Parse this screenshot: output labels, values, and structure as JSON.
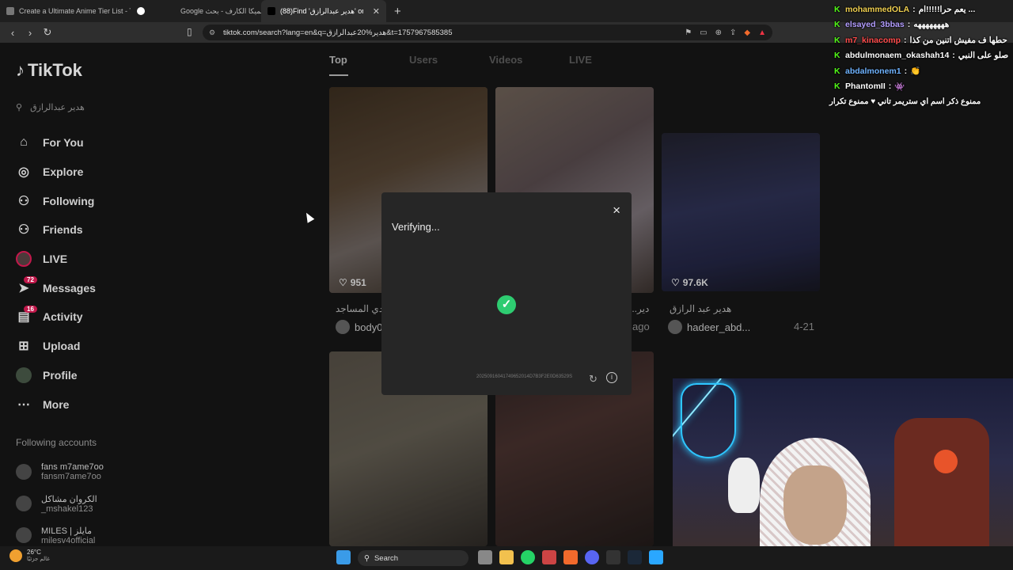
{
  "browser": {
    "tabs": [
      {
        "label": "Create a Ultimate Anime Tier List - Ti",
        "active": false
      },
      {
        "label": "",
        "active": false
      },
      {
        "label": "Google هميكا الكارف - بحث",
        "active": false
      },
      {
        "label": "(88)Find 'هدير عبدالرازق' on TikTo",
        "active": true
      }
    ],
    "url": "tiktok.com/search?lang=en&q=هدير%20عبدالرازق&t=1757967585385"
  },
  "sidebar": {
    "logo": "TikTok",
    "search_placeholder": "هدير عبدالرازق",
    "nav": [
      {
        "label": "For You",
        "icon": "home-icon"
      },
      {
        "label": "Explore",
        "icon": "compass-icon"
      },
      {
        "label": "Following",
        "icon": "following-icon"
      },
      {
        "label": "Friends",
        "icon": "friends-icon"
      },
      {
        "label": "LIVE",
        "icon": "live-icon"
      },
      {
        "label": "Messages",
        "icon": "messages-icon",
        "badge": "72"
      },
      {
        "label": "Activity",
        "icon": "activity-icon",
        "badge": "16"
      },
      {
        "label": "Upload",
        "icon": "upload-icon"
      },
      {
        "label": "Profile",
        "icon": "profile-icon"
      },
      {
        "label": "More",
        "icon": "more-icon"
      }
    ],
    "following_title": "Following accounts",
    "following": [
      {
        "name": "fans m7ame7oo",
        "handle": "fansm7ame7oo"
      },
      {
        "name": "الكروان مشاكل",
        "handle": "_mshakel123"
      },
      {
        "name": "MILES | مايلز",
        "handle": "milesv4official"
      }
    ]
  },
  "main": {
    "tabs": [
      "Top",
      "Users",
      "Videos",
      "LIVE"
    ],
    "cards": [
      {
        "likes": "951",
        "desc": "تحدي المساجد",
        "author": "body0",
        "date": ""
      },
      {
        "likes": "",
        "desc": "...دير",
        "author": "",
        "date": "ago"
      },
      {
        "likes": "97.6K",
        "desc": "هدير عبد الرازق",
        "author": "hadeer_abd...",
        "date": "4-21"
      }
    ]
  },
  "modal": {
    "title": "Verifying...",
    "code": "20250916041749652014D7B3F2E0D63529S",
    "close": "×"
  },
  "chat": {
    "messages": [
      {
        "user": "mohammedOLA",
        "text": "يعم حرا!!!!!ام ...",
        "color": "#f0d050"
      },
      {
        "user": "elsayed_3bbas",
        "text": "ههههههههه",
        "color": "#b39dff"
      },
      {
        "user": "m7_kinacomp",
        "text": "حطها ف مفيش اتنين من كذا",
        "color": "#ff4b4b"
      },
      {
        "user": "abdulmonaem_okashah14",
        "text": "صلو على النبي",
        "color": "#ffffff"
      },
      {
        "user": "abdalmonem1",
        "text": "👏",
        "color": "#6fb3ff"
      },
      {
        "user": "PhantomII",
        "text": "👾",
        "color": "#ffffff"
      }
    ],
    "pinned": "ممنوع ذكر اسم اي ستريمر تاني ♥ ممنوع تكرار"
  },
  "taskbar": {
    "temp": "26°C",
    "weather_desc": "غالم جزئيًا",
    "search": "Search"
  }
}
